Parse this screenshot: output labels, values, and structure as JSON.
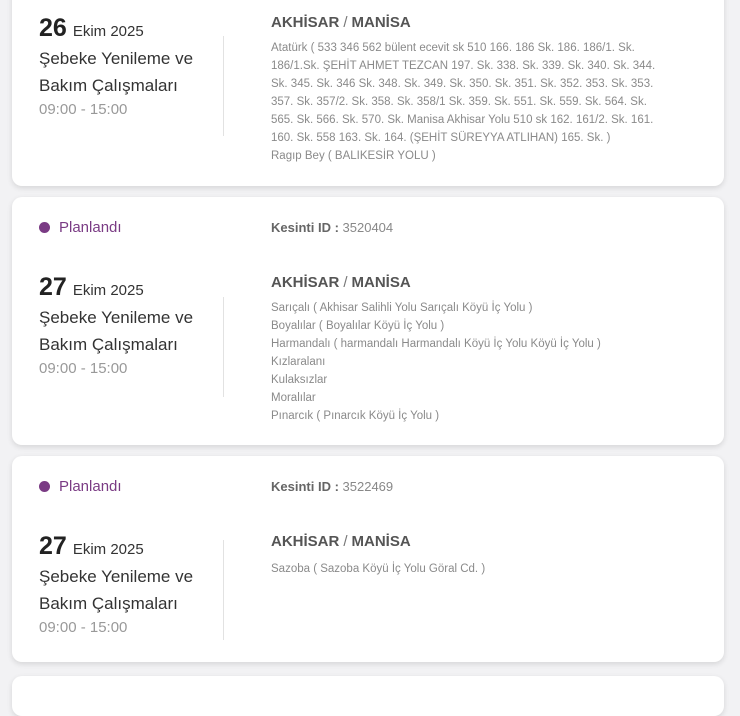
{
  "cards": [
    {
      "day": "26",
      "month_year": "Ekim 2025",
      "title_line1": "Şebeke Yenileme ve",
      "title_line2": "Bakım Çalışmaları",
      "time": "09:00 - 15:00",
      "district": "AKHİSAR",
      "separator": "/",
      "province": "MANİSA",
      "streets": [
        "Atatürk ( 533 346 562 bülent ecevit sk 510 166. 186 Sk. 186. 186/1. Sk. 186/1.Sk. ŞEHİT AHMET TEZCAN 197. Sk. 338. Sk. 339. Sk. 340. Sk. 344. Sk. 345. Sk. 346 Sk. 348. Sk. 349. Sk. 350. Sk. 351. Sk. 352. 353. Sk. 353. 357. Sk. 357/2. Sk. 358. Sk. 358/1 Sk. 359. Sk. 551. Sk. 559. Sk. 564. Sk. 565. Sk. 566. Sk. 570. Sk. Manisa Akhisar Yolu 510 sk 162. 161/2. Sk. 161. 160. Sk. 558 163. Sk. 164. (ŞEHİT SÜREYYA ATLIHAN) 165. Sk. )",
        "Ragıp Bey ( BALIKESİR YOLU )"
      ]
    },
    {
      "status": "Planlandı",
      "outage_label": "Kesinti ID :",
      "outage_id": "3520404",
      "day": "27",
      "month_year": "Ekim 2025",
      "title_line1": "Şebeke Yenileme ve",
      "title_line2": "Bakım Çalışmaları",
      "time": "09:00 - 15:00",
      "district": "AKHİSAR",
      "separator": "/",
      "province": "MANİSA",
      "streets": [
        "Sarıçalı ( Akhisar Salihli Yolu Sarıçalı Köyü İç Yolu )",
        "Boyalılar ( Boyalılar Köyü İç Yolu )",
        "Harmandalı ( harmandalı Harmandalı Köyü İç Yolu Köyü İç Yolu )",
        "Kızlaralanı",
        "Kulaksızlar",
        "Moralılar",
        "Pınarcık ( Pınarcık Köyü İç Yolu )"
      ]
    },
    {
      "status": "Planlandı",
      "outage_label": "Kesinti ID :",
      "outage_id": "3522469",
      "day": "27",
      "month_year": "Ekim 2025",
      "title_line1": "Şebeke Yenileme ve",
      "title_line2": "Bakım Çalışmaları",
      "time": "09:00 - 15:00",
      "district": "AKHİSAR",
      "separator": "/",
      "province": "MANİSA",
      "streets": [
        "Sazoba ( Sazoba Köyü İç Yolu Göral Cd. )"
      ]
    }
  ],
  "colors": {
    "status": "#7a3b84",
    "background": "#f2f2f4",
    "card": "#ffffff"
  }
}
